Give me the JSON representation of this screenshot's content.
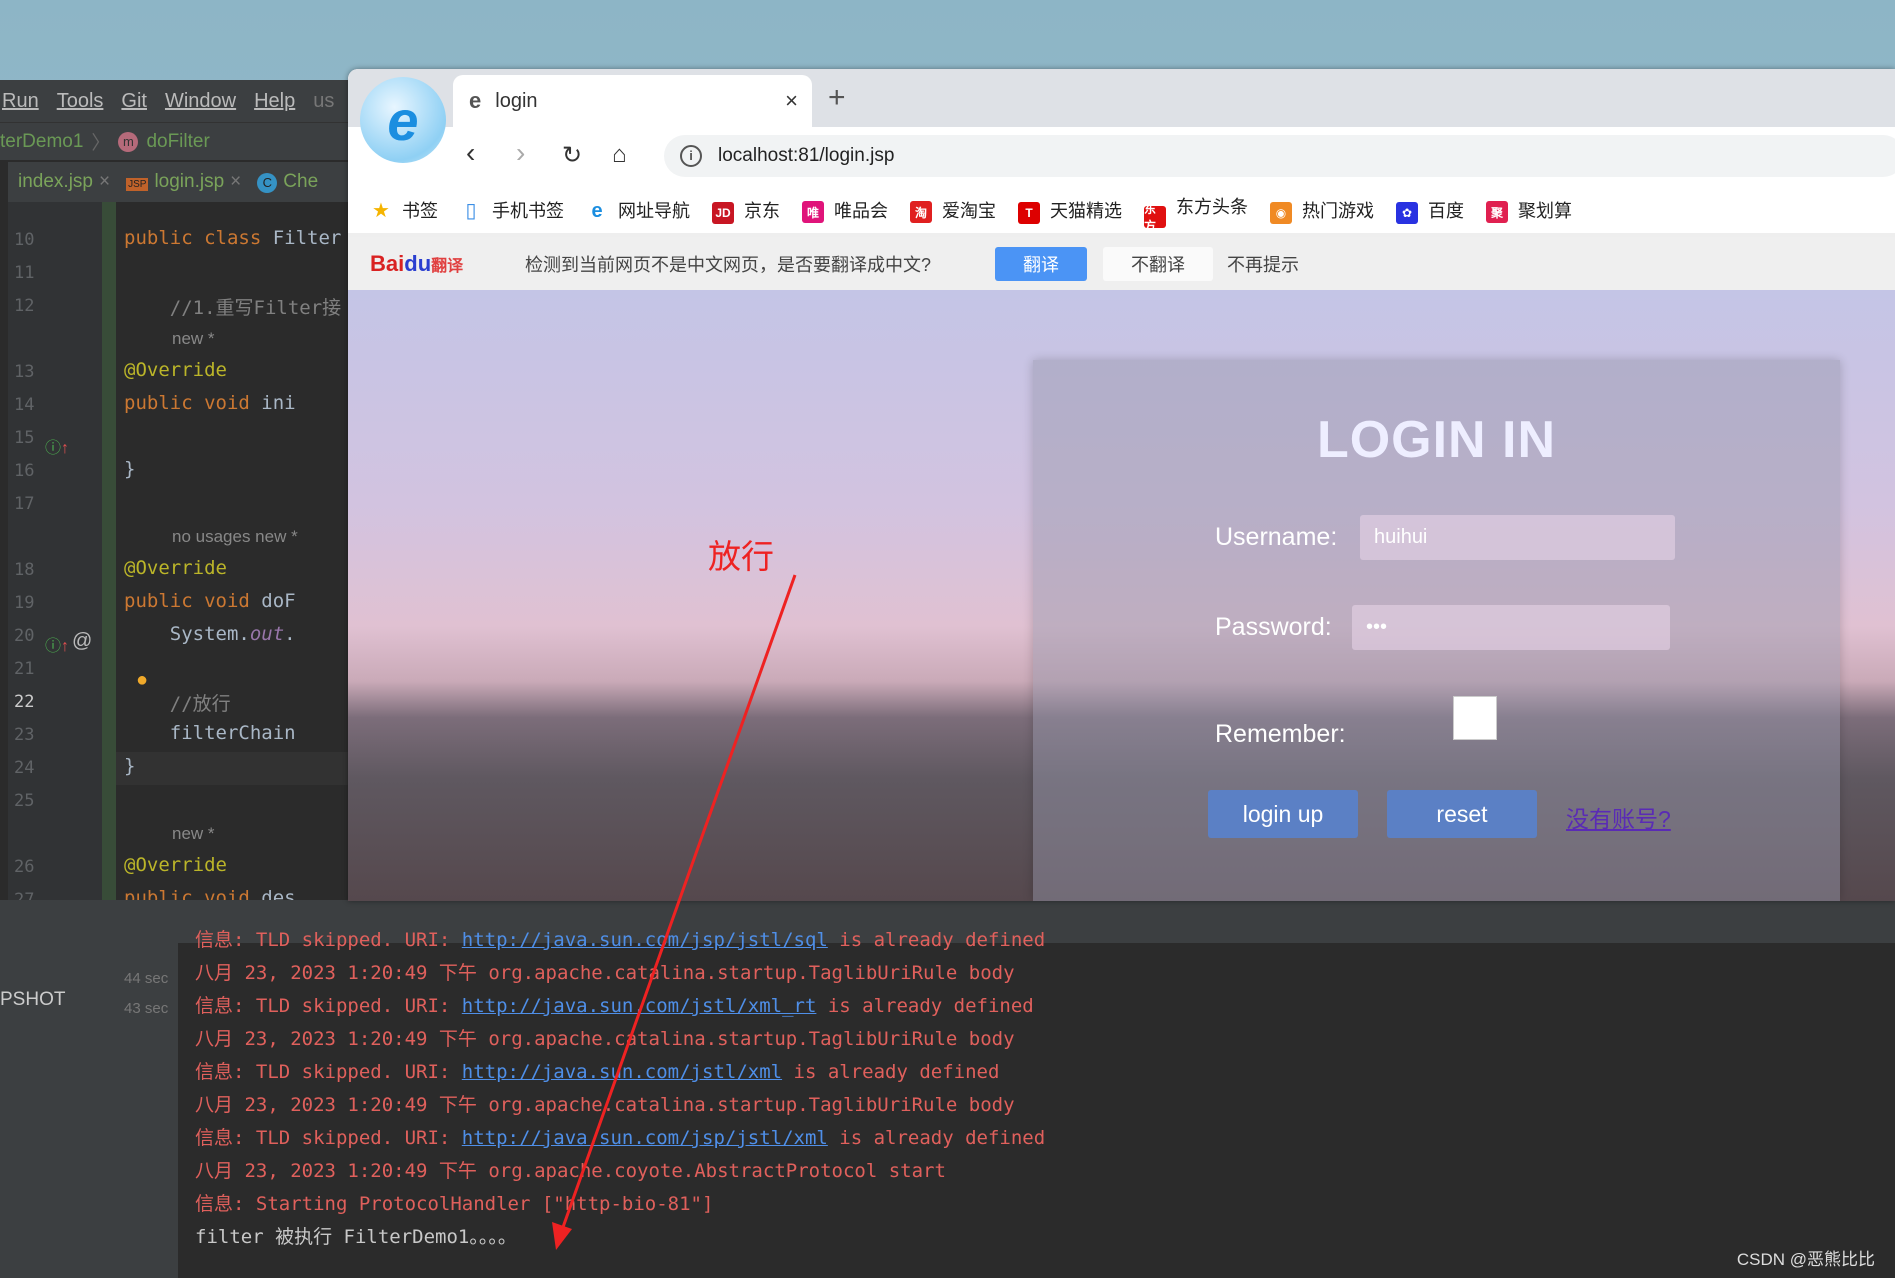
{
  "ide": {
    "menu": [
      "Run",
      "Tools",
      "Git",
      "Window",
      "Help"
    ],
    "menu_trailing": "us",
    "breadcrumb": {
      "class": "terDemo1",
      "method_badge": "m",
      "method": "doFilter"
    },
    "tabs": [
      "index.jsp",
      "login.jsp",
      "Che"
    ],
    "code": [
      {
        "ln": "10",
        "parts": [
          [
            "kw",
            "public class "
          ],
          [
            "",
            "Filter"
          ]
        ]
      },
      {
        "ln": "11",
        "parts": []
      },
      {
        "ln": "12",
        "parts": [
          [
            "cm",
            "    //1.重写Filter接"
          ]
        ]
      },
      {
        "hint": "new *"
      },
      {
        "ln": "13",
        "parts": [
          [
            "ann",
            "@Override"
          ]
        ]
      },
      {
        "ln": "14",
        "parts": [
          [
            "kw",
            "public void "
          ],
          [
            "",
            "ini"
          ]
        ]
      },
      {
        "ln": "15",
        "parts": []
      },
      {
        "ln": "16",
        "parts": [
          [
            "",
            "}"
          ]
        ]
      },
      {
        "ln": "17",
        "parts": []
      },
      {
        "hint": "no usages   new *"
      },
      {
        "ln": "18",
        "parts": [
          [
            "ann",
            "@Override"
          ]
        ]
      },
      {
        "ln": "19",
        "parts": [
          [
            "kw",
            "public void "
          ],
          [
            "",
            "doF"
          ]
        ]
      },
      {
        "ln": "20",
        "parts": [
          [
            "",
            "    System."
          ],
          [
            "it",
            "out"
          ],
          [
            "",
            "."
          ]
        ]
      },
      {
        "ln": "21",
        "parts": []
      },
      {
        "ln": "22",
        "parts": [
          [
            "cm",
            "    //放行"
          ]
        ]
      },
      {
        "ln": "23",
        "parts": [
          [
            "",
            "    filterChain"
          ]
        ]
      },
      {
        "ln": "24",
        "parts": [
          [
            "",
            "}"
          ]
        ]
      },
      {
        "ln": "25",
        "parts": []
      },
      {
        "hint": "new *"
      },
      {
        "ln": "26",
        "parts": [
          [
            "ann",
            "@Override"
          ]
        ]
      },
      {
        "ln": "27",
        "parts": [
          [
            "kw",
            "public void "
          ],
          [
            "",
            "des"
          ]
        ]
      }
    ],
    "current_line": "22"
  },
  "run_panel": {
    "items": [
      {
        "label": "",
        "time": "44 sec"
      },
      {
        "label": "PSHOT",
        "time": "43 sec"
      }
    ]
  },
  "console": [
    {
      "pre": "信息: TLD skipped. URI: ",
      "link": "http://java.sun.com/jsp/jstl/sql",
      "post": " is already defined"
    },
    {
      "pre": "八月 23, 2023 1:20:49 下午 org.apache.catalina.startup.TaglibUriRule body"
    },
    {
      "pre": "信息: TLD skipped. URI: ",
      "link": "http://java.sun.com/jstl/xml_rt",
      "post": " is already defined"
    },
    {
      "pre": "八月 23, 2023 1:20:49 下午 org.apache.catalina.startup.TaglibUriRule body"
    },
    {
      "pre": "信息: TLD skipped. URI: ",
      "link": "http://java.sun.com/jstl/xml",
      "post": " is already defined"
    },
    {
      "pre": "八月 23, 2023 1:20:49 下午 org.apache.catalina.startup.TaglibUriRule body"
    },
    {
      "pre": "信息: TLD skipped. URI: ",
      "link": "http://java.sun.com/jsp/jstl/xml",
      "post": " is already defined"
    },
    {
      "pre": "八月 23, 2023 1:20:49 下午 org.apache.coyote.AbstractProtocol start"
    },
    {
      "pre": "信息: Starting ProtocolHandler [\"http-bio-81\"]"
    },
    {
      "pre": "filter 被执行 FilterDemo1。。。。",
      "white": true
    }
  ],
  "browser": {
    "tab_title": "login",
    "new_tab": "+",
    "close": "×",
    "url": "localhost:81/login.jsp",
    "bookmarks": [
      {
        "label": "书签",
        "icon": "★",
        "color": "#f5b400"
      },
      {
        "label": "手机书签",
        "icon": "▯",
        "color": "#3a8ee6"
      },
      {
        "label": "网址导航",
        "icon": "e",
        "color": "#1b8ee0"
      },
      {
        "label": "京东",
        "icon": "JD",
        "color": "#c81623"
      },
      {
        "label": "唯品会",
        "icon": "唯",
        "color": "#e0147a"
      },
      {
        "label": "爱淘宝",
        "icon": "淘",
        "color": "#e02020"
      },
      {
        "label": "天猫精选",
        "icon": "T",
        "color": "#d00"
      },
      {
        "label": "东方头条",
        "icon": "东方",
        "color": "#e01010"
      },
      {
        "label": "热门游戏",
        "icon": "◉",
        "color": "#f08a24"
      },
      {
        "label": "百度",
        "icon": "✿",
        "color": "#2932e1"
      },
      {
        "label": "聚划算",
        "icon": "聚",
        "color": "#e02050"
      }
    ],
    "translate": {
      "brand": "Bai",
      "brand2": "du",
      "brand3": "翻译",
      "message": "检测到当前网页不是中文网页，是否要翻译成中文?",
      "translate": "翻译",
      "no_translate": "不翻译",
      "dont_remind": "不再提示",
      "accent": "#4b94f5"
    },
    "login": {
      "title": "LOGIN IN",
      "username_label": "Username:",
      "username_value": "huihui",
      "password_label": "Password:",
      "password_value": "•••",
      "remember_label": "Remember:",
      "remember_checked": false,
      "login_button": "login up",
      "reset_button": "reset",
      "register_link": "没有账号?"
    }
  },
  "annotation": {
    "text": "放行",
    "color": "#ee2222"
  },
  "watermark": "CSDN @恶熊比比"
}
